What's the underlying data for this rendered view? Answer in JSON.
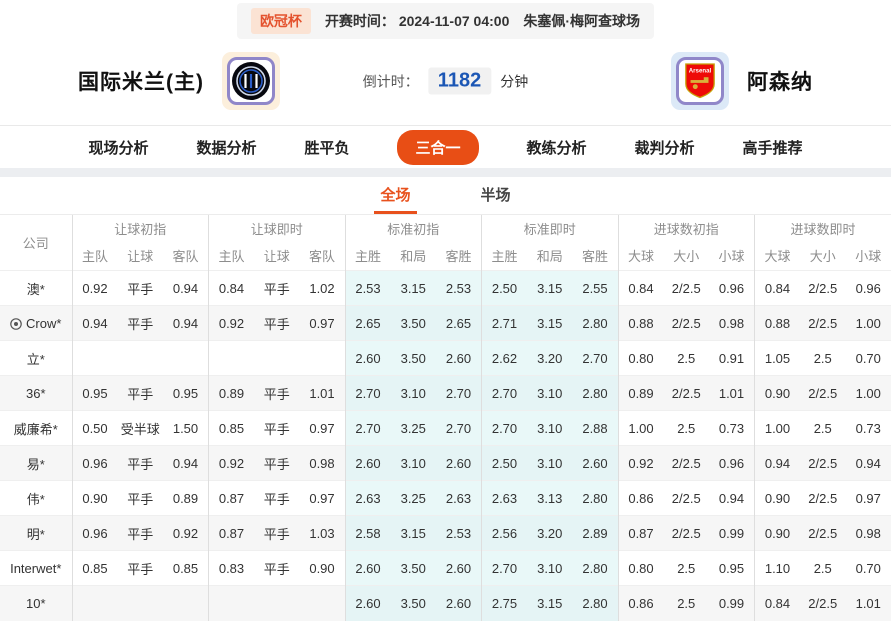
{
  "header": {
    "league": "欧冠杯",
    "kickoff_label": "开赛时间：",
    "kickoff_time": "2024-11-07 04:00",
    "venue": "朱塞佩·梅阿查球场"
  },
  "match": {
    "home_name": "国际米兰(主)",
    "away_name": "阿森纳",
    "home_logo": "inter-milan-crest",
    "away_logo": "arsenal-crest",
    "countdown_label": "倒计时：",
    "countdown_value": "1182",
    "countdown_unit": "分钟"
  },
  "nav": {
    "tabs": [
      {
        "label": "现场分析",
        "active": false
      },
      {
        "label": "数据分析",
        "active": false
      },
      {
        "label": "胜平负",
        "active": false
      },
      {
        "label": "三合一",
        "active": true
      },
      {
        "label": "教练分析",
        "active": false
      },
      {
        "label": "裁判分析",
        "active": false
      },
      {
        "label": "高手推荐",
        "active": false
      }
    ]
  },
  "subtabs": [
    {
      "label": "全场",
      "active": true
    },
    {
      "label": "半场",
      "active": false
    }
  ],
  "table": {
    "company_header": "公司",
    "groups": [
      {
        "key": "handicap_initial",
        "label": "让球初指",
        "cols": [
          "主队",
          "让球",
          "客队"
        ],
        "live": false,
        "tint": false
      },
      {
        "key": "handicap_live",
        "label": "让球即时",
        "cols": [
          "主队",
          "让球",
          "客队"
        ],
        "live": true,
        "tint": false
      },
      {
        "key": "standard_initial",
        "label": "标准初指",
        "cols": [
          "主胜",
          "和局",
          "客胜"
        ],
        "live": false,
        "tint": true
      },
      {
        "key": "standard_live",
        "label": "标准即时",
        "cols": [
          "主胜",
          "和局",
          "客胜"
        ],
        "live": true,
        "tint": true
      },
      {
        "key": "goals_initial",
        "label": "进球数初指",
        "cols": [
          "大球",
          "大小",
          "小球"
        ],
        "live": false,
        "tint": false
      },
      {
        "key": "goals_live",
        "label": "进球数即时",
        "cols": [
          "大球",
          "大小",
          "小球"
        ],
        "live": true,
        "tint": false
      }
    ],
    "rows": [
      {
        "company": "澳*",
        "icon": "",
        "handicap_initial": [
          "0.92",
          "平手",
          "0.94"
        ],
        "handicap_live": [
          "0.84",
          "平手",
          "1.02"
        ],
        "standard_initial": [
          "2.53",
          "3.15",
          "2.53"
        ],
        "standard_live": [
          "2.50",
          "3.15",
          "2.55"
        ],
        "goals_initial": [
          "0.84",
          "2/2.5",
          "0.96"
        ],
        "goals_live": [
          "0.84",
          "2/2.5",
          "0.96"
        ]
      },
      {
        "company": "Crow*",
        "icon": "soccer-ball",
        "handicap_initial": [
          "0.94",
          "平手",
          "0.94"
        ],
        "handicap_live": [
          "0.92",
          "平手",
          "0.97"
        ],
        "standard_initial": [
          "2.65",
          "3.50",
          "2.65"
        ],
        "standard_live": [
          "2.71",
          "3.15",
          "2.80"
        ],
        "goals_initial": [
          "0.88",
          "2/2.5",
          "0.98"
        ],
        "goals_live": [
          "0.88",
          "2/2.5",
          "1.00"
        ]
      },
      {
        "company": "立*",
        "icon": "",
        "handicap_initial": [
          "",
          "",
          ""
        ],
        "handicap_live": [
          "",
          "",
          ""
        ],
        "standard_initial": [
          "2.60",
          "3.50",
          "2.60"
        ],
        "standard_live": [
          "2.62",
          "3.20",
          "2.70"
        ],
        "goals_initial": [
          "0.80",
          "2.5",
          "0.91"
        ],
        "goals_live": [
          "1.05",
          "2.5",
          "0.70"
        ]
      },
      {
        "company": "36*",
        "icon": "",
        "handicap_initial": [
          "0.95",
          "平手",
          "0.95"
        ],
        "handicap_live": [
          "0.89",
          "平手",
          "1.01"
        ],
        "standard_initial": [
          "2.70",
          "3.10",
          "2.70"
        ],
        "standard_live": [
          "2.70",
          "3.10",
          "2.80"
        ],
        "goals_initial": [
          "0.89",
          "2/2.5",
          "1.01"
        ],
        "goals_live": [
          "0.90",
          "2/2.5",
          "1.00"
        ]
      },
      {
        "company": "威廉希*",
        "icon": "",
        "handicap_initial": [
          "0.50",
          "受半球",
          "1.50"
        ],
        "handicap_live": [
          "0.85",
          "平手",
          "0.97"
        ],
        "standard_initial": [
          "2.70",
          "3.25",
          "2.70"
        ],
        "standard_live": [
          "2.70",
          "3.10",
          "2.88"
        ],
        "goals_initial": [
          "1.00",
          "2.5",
          "0.73"
        ],
        "goals_live": [
          "1.00",
          "2.5",
          "0.73"
        ]
      },
      {
        "company": "易*",
        "icon": "",
        "handicap_initial": [
          "0.96",
          "平手",
          "0.94"
        ],
        "handicap_live": [
          "0.92",
          "平手",
          "0.98"
        ],
        "standard_initial": [
          "2.60",
          "3.10",
          "2.60"
        ],
        "standard_live": [
          "2.50",
          "3.10",
          "2.60"
        ],
        "goals_initial": [
          "0.92",
          "2/2.5",
          "0.96"
        ],
        "goals_live": [
          "0.94",
          "2/2.5",
          "0.94"
        ]
      },
      {
        "company": "伟*",
        "icon": "",
        "handicap_initial": [
          "0.90",
          "平手",
          "0.89"
        ],
        "handicap_live": [
          "0.87",
          "平手",
          "0.97"
        ],
        "standard_initial": [
          "2.63",
          "3.25",
          "2.63"
        ],
        "standard_live": [
          "2.63",
          "3.13",
          "2.80"
        ],
        "goals_initial": [
          "0.86",
          "2/2.5",
          "0.94"
        ],
        "goals_live": [
          "0.90",
          "2/2.5",
          "0.97"
        ]
      },
      {
        "company": "明*",
        "icon": "",
        "handicap_initial": [
          "0.96",
          "平手",
          "0.92"
        ],
        "handicap_live": [
          "0.87",
          "平手",
          "1.03"
        ],
        "standard_initial": [
          "2.58",
          "3.15",
          "2.53"
        ],
        "standard_live": [
          "2.56",
          "3.20",
          "2.89"
        ],
        "goals_initial": [
          "0.87",
          "2/2.5",
          "0.99"
        ],
        "goals_live": [
          "0.90",
          "2/2.5",
          "0.98"
        ]
      },
      {
        "company": "Interwet*",
        "icon": "",
        "handicap_initial": [
          "0.85",
          "平手",
          "0.85"
        ],
        "handicap_live": [
          "0.83",
          "平手",
          "0.90"
        ],
        "standard_initial": [
          "2.60",
          "3.50",
          "2.60"
        ],
        "standard_live": [
          "2.70",
          "3.10",
          "2.80"
        ],
        "goals_initial": [
          "0.80",
          "2.5",
          "0.95"
        ],
        "goals_live": [
          "1.10",
          "2.5",
          "0.70"
        ]
      },
      {
        "company": "10*",
        "icon": "",
        "handicap_initial": [
          "",
          "",
          ""
        ],
        "handicap_live": [
          "",
          "",
          ""
        ],
        "standard_initial": [
          "2.60",
          "3.50",
          "2.60"
        ],
        "standard_live": [
          "2.75",
          "3.15",
          "2.80"
        ],
        "goals_initial": [
          "0.86",
          "2.5",
          "0.99"
        ],
        "goals_live": [
          "0.84",
          "2/2.5",
          "1.01"
        ]
      }
    ]
  },
  "colors": {
    "accent_orange": "#E84E15",
    "badge_bg": "#FBE3D4",
    "badge_text": "#E4532F",
    "live_blue": "#2C5FB8",
    "countdown_blue": "#1C57B5",
    "tint_cyan": "#E9F8F8",
    "stripe_gray": "#F6F6F6"
  }
}
